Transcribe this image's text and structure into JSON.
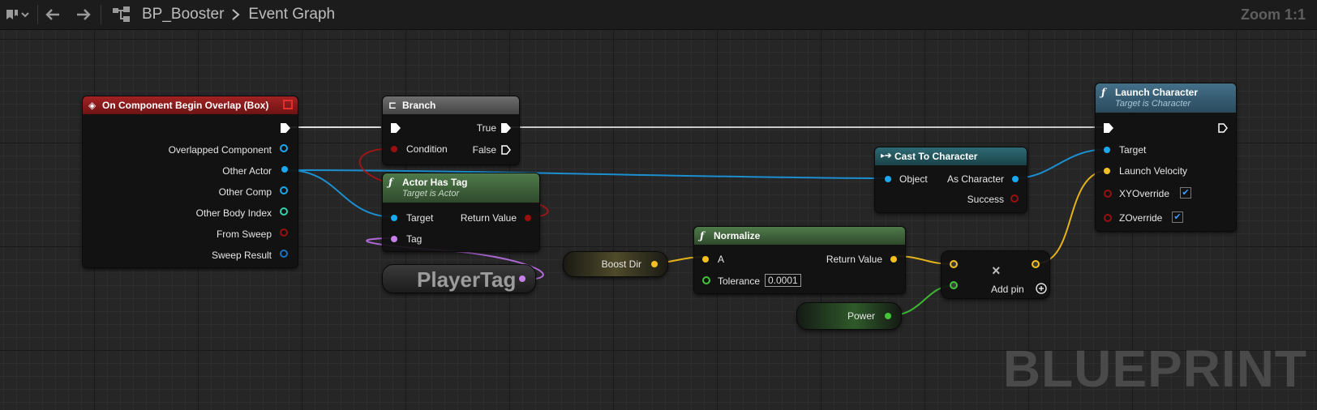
{
  "toolbar": {
    "blueprint_name": "BP_Booster",
    "graph_name": "Event Graph",
    "zoom": "Zoom 1:1"
  },
  "watermark": "BLUEPRINT",
  "nodes": {
    "overlap": {
      "title": "On Component Begin Overlap (Box)",
      "pins": [
        "Overlapped Component",
        "Other Actor",
        "Other Comp",
        "Other Body Index",
        "From Sweep",
        "Sweep Result"
      ]
    },
    "branch": {
      "title": "Branch",
      "condition": "Condition",
      "true": "True",
      "false": "False"
    },
    "has_tag": {
      "title": "Actor Has Tag",
      "subtitle": "Target is Actor",
      "target": "Target",
      "tag": "Tag",
      "return": "Return Value"
    },
    "player_tag": {
      "value": "PlayerTag"
    },
    "boost_dir": {
      "label": "Boost Dir"
    },
    "normalize": {
      "title": "Normalize",
      "a": "A",
      "tolerance": "Tolerance",
      "tolerance_value": "0.0001",
      "return": "Return Value"
    },
    "power": {
      "label": "Power"
    },
    "add": {
      "symbol": "×",
      "add_pin": "Add pin"
    },
    "cast": {
      "title": "Cast To Character",
      "object": "Object",
      "as": "As Character",
      "success": "Success"
    },
    "launch": {
      "title": "Launch Character",
      "subtitle": "Target is Character",
      "target": "Target",
      "velocity": "Launch Velocity",
      "xy": "XYOverride",
      "z": "ZOverride"
    }
  },
  "colors": {
    "exec": "#ffffff",
    "object": "#1aa8f0",
    "vector": "#f5c01f",
    "float": "#44c53a",
    "bool": "#9a1010",
    "name": "#c77fe8",
    "struct": "#1a73c0",
    "int": "#2fd3a8"
  }
}
